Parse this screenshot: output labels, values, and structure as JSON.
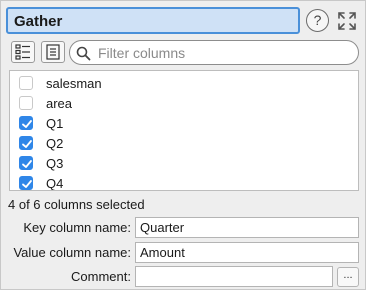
{
  "header": {
    "title": "Gather",
    "help_label": "?"
  },
  "toolbar": {
    "filter_placeholder": "Filter columns"
  },
  "columns": [
    {
      "label": "salesman",
      "checked": false
    },
    {
      "label": "area",
      "checked": false
    },
    {
      "label": "Q1",
      "checked": true
    },
    {
      "label": "Q2",
      "checked": true
    },
    {
      "label": "Q3",
      "checked": true
    },
    {
      "label": "Q4",
      "checked": true
    }
  ],
  "status": {
    "selected_text": "4 of 6 columns selected"
  },
  "fields": {
    "key_label": "Key column name:",
    "key_value": "Quarter",
    "value_label": "Value column name:",
    "value_value": "Amount",
    "comment_label": "Comment:",
    "comment_value": "",
    "more_label": "..."
  },
  "colors": {
    "title_bg": "#cfe1f6",
    "title_border": "#4a90d9",
    "checkbox_checked": "#2f86e8"
  }
}
